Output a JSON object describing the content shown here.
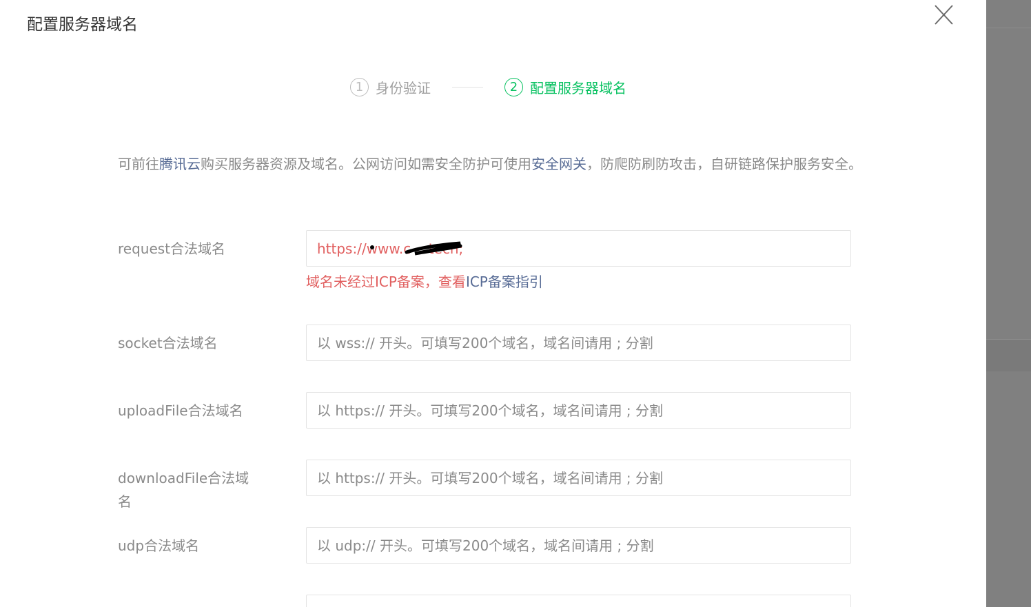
{
  "dialog": {
    "title": "配置服务器域名"
  },
  "steps": [
    {
      "number": "1",
      "label": "身份验证",
      "active": false
    },
    {
      "number": "2",
      "label": "配置服务器域名",
      "active": true
    }
  ],
  "intro": {
    "text_1": "可前往",
    "link_1": "腾讯云",
    "text_2": "购买服务器资源及域名。公网访问如需安全防护可使用",
    "link_2": "安全网关",
    "text_3": "，防爬防刷防攻击，自研链路保护服务安全。"
  },
  "fields": {
    "request": {
      "label": "request合法域名",
      "value": "https://www.c    tech;",
      "error_text": "域名未经过ICP备案，查看",
      "error_link": "ICP备案指引"
    },
    "socket": {
      "label": "socket合法域名",
      "placeholder": "以 wss:// 开头。可填写200个域名，域名间请用 ; 分割"
    },
    "uploadFile": {
      "label": "uploadFile合法域名",
      "placeholder": "以 https:// 开头。可填写200个域名，域名间请用 ; 分割"
    },
    "downloadFile": {
      "label": "downloadFile合法域名",
      "placeholder": "以 https:// 开头。可填写200个域名，域名间请用 ; 分割"
    },
    "udp": {
      "label": "udp合法域名",
      "placeholder": "以 udp:// 开头。可填写200个域名，域名间请用 ; 分割"
    }
  },
  "colors": {
    "accent": "#07c160",
    "link": "#576b95",
    "error": "#e15f5f",
    "backdrop": "#808080"
  }
}
